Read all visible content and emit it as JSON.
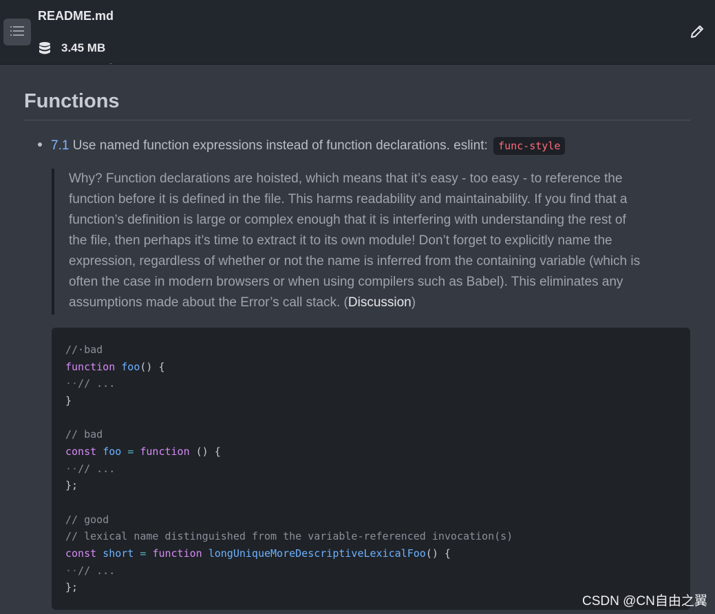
{
  "header": {
    "file_name": "README.md",
    "file_size": "3.45 MB",
    "toc_icon": "list-icon",
    "size_icon": "database-icon",
    "edit_icon": "pencil-icon"
  },
  "content": {
    "heading": "Functions",
    "rule": {
      "number": "7.1",
      "text": " Use named function expressions instead of function declarations. eslint: ",
      "lint_code": "func-style"
    },
    "blockquote": {
      "lines": [
        "Why? Function declarations are hoisted, which means that it’s easy - too easy - to reference the",
        "function before it is defined in the file. This harms readability and maintainability. If you find that a",
        "function’s definition is large or complex enough that it is interfering with understanding the rest of",
        "the file, then perhaps it’s time to extract it to its own module! Don’t forget to explicitly name the",
        "expression, regardless of whether or not the name is inferred from the containing variable (which is",
        "often the case in modern browsers or when using compilers such as Babel). This eliminates any"
      ],
      "last_line_prefix": "assumptions made about the Error’s call stack. (",
      "link_text": "Discussion",
      "last_line_suffix": ")"
    },
    "code": {
      "l1_comment": "//·bad",
      "l2_kw": "function",
      "l2_fn": "foo",
      "l2_rest": "() {",
      "l3_indent": "··",
      "l3_comment": "// ...",
      "l4_close": "}",
      "l6_comment": "// bad",
      "l7_kw1": "const",
      "l7_name": "foo",
      "l7_eq": "=",
      "l7_kw2": "function",
      "l7_rest": "() {",
      "l8_indent": "··",
      "l8_comment": "// ...",
      "l9_close": "};",
      "l11_comment": "// good",
      "l12_comment": "// lexical name distinguished from the variable-referenced invocation(s)",
      "l13_kw1": "const",
      "l13_name": "short",
      "l13_eq": "=",
      "l13_kw2": "function",
      "l13_fn": "longUniqueMoreDescriptiveLexicalFoo",
      "l13_rest": "() {",
      "l14_indent": "··",
      "l14_comment": "// ...",
      "l15_close": "};"
    }
  },
  "watermark": "CSDN @CN自由之翼",
  "colors": {
    "background": "#353941",
    "header": "#22262d",
    "code_background": "#1f2227",
    "keyword": "#d58af5",
    "function_name": "#6cb2ff",
    "lint_code": "#ff6b7a"
  }
}
